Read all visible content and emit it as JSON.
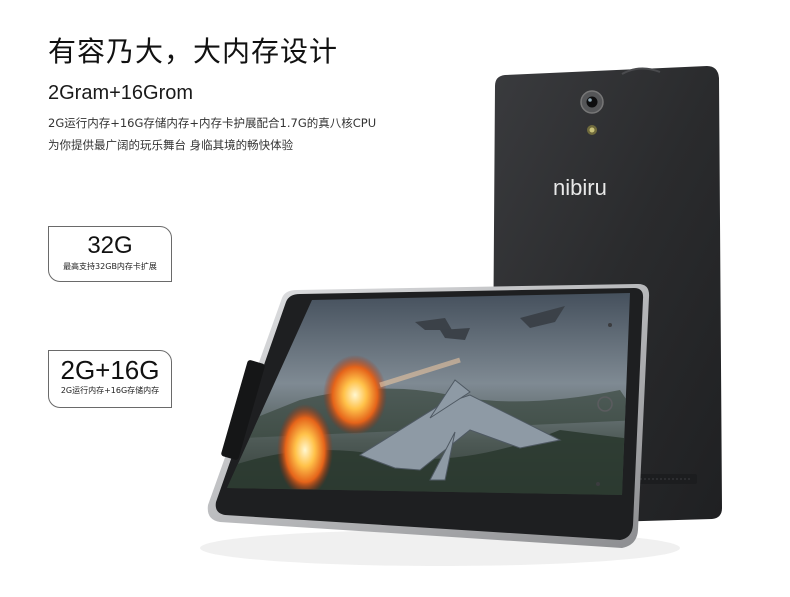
{
  "headline": "有容乃大，大内存设计",
  "subhead": "2Gram+16Grom",
  "desc_lines": [
    "2G运行内存+16G存储内存+内存卡护展配合1.7G的真八核CPU",
    "为你提供最广阔的玩乐舞台 身临其境的畅快体验"
  ],
  "badges": [
    {
      "big": "32G",
      "small": "最高支持32GB内存卡扩展"
    },
    {
      "big": "2G+16G",
      "small": "2G运行内存+16G存储内存"
    }
  ],
  "brand_logo": "nibiru",
  "colors": {
    "device_body": "#2b2c2e",
    "bezel": "#1c1d1f",
    "frame": "#c9cacc",
    "text_dark": "#111111"
  },
  "icons": [
    "camera-lens-icon",
    "flash-icon",
    "home-button-icon"
  ]
}
